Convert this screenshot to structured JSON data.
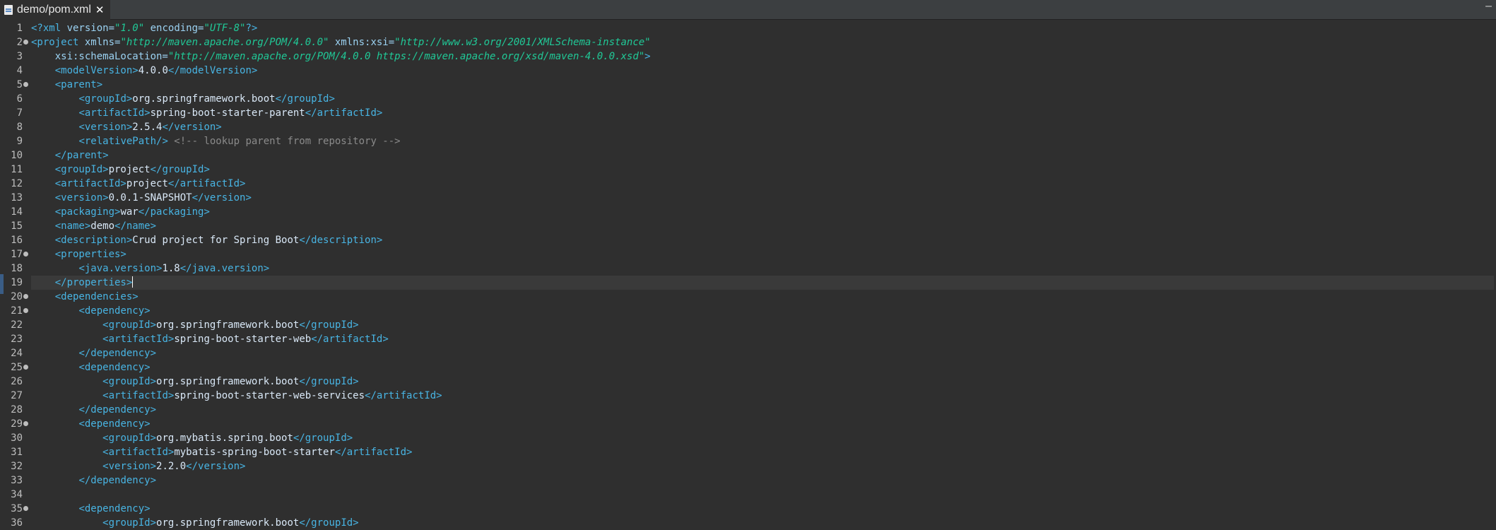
{
  "tab": {
    "title": "demo/pom.xml",
    "close_glyph": "✕"
  },
  "window": {
    "control": "–"
  },
  "lines": [
    {
      "n": "1",
      "segments": [
        [
          "tag",
          "<?xml "
        ],
        [
          "attr",
          "version="
        ],
        [
          "val",
          "\"1.0\""
        ],
        [
          "attr",
          " encoding="
        ],
        [
          "val",
          "\"UTF-8\""
        ],
        [
          "tag",
          "?>"
        ]
      ]
    },
    {
      "n": "2",
      "fold": true,
      "segments": [
        [
          "tag",
          "<project "
        ],
        [
          "attr",
          "xmlns="
        ],
        [
          "val",
          "\"http://maven.apache.org/POM/4.0.0\""
        ],
        [
          "attr",
          " xmlns:xsi="
        ],
        [
          "val",
          "\"http://www.w3.org/2001/XMLSchema-instance\""
        ]
      ]
    },
    {
      "n": "3",
      "segments": [
        [
          "attr",
          "    xsi:schemaLocation="
        ],
        [
          "val",
          "\"http://maven.apache.org/POM/4.0.0 https://maven.apache.org/xsd/maven-4.0.0.xsd\""
        ],
        [
          "tag",
          ">"
        ]
      ]
    },
    {
      "n": "4",
      "segments": [
        [
          "text",
          "    "
        ],
        [
          "tag",
          "<modelVersion>"
        ],
        [
          "text",
          "4.0.0"
        ],
        [
          "tag",
          "</modelVersion>"
        ]
      ]
    },
    {
      "n": "5",
      "fold": true,
      "segments": [
        [
          "text",
          "    "
        ],
        [
          "tag",
          "<parent>"
        ]
      ]
    },
    {
      "n": "6",
      "segments": [
        [
          "text",
          "        "
        ],
        [
          "tag",
          "<groupId>"
        ],
        [
          "text",
          "org.springframework.boot"
        ],
        [
          "tag",
          "</groupId>"
        ]
      ]
    },
    {
      "n": "7",
      "segments": [
        [
          "text",
          "        "
        ],
        [
          "tag",
          "<artifactId>"
        ],
        [
          "text",
          "spring-boot-starter-parent"
        ],
        [
          "tag",
          "</artifactId>"
        ]
      ]
    },
    {
      "n": "8",
      "segments": [
        [
          "text",
          "        "
        ],
        [
          "tag",
          "<version>"
        ],
        [
          "text",
          "2.5.4"
        ],
        [
          "tag",
          "</version>"
        ]
      ]
    },
    {
      "n": "9",
      "segments": [
        [
          "text",
          "        "
        ],
        [
          "tag",
          "<relativePath/>"
        ],
        [
          "comment",
          " <!-- lookup parent from repository -->"
        ]
      ]
    },
    {
      "n": "10",
      "segments": [
        [
          "text",
          "    "
        ],
        [
          "tag",
          "</parent>"
        ]
      ]
    },
    {
      "n": "11",
      "segments": [
        [
          "text",
          "    "
        ],
        [
          "tag",
          "<groupId>"
        ],
        [
          "text",
          "project"
        ],
        [
          "tag",
          "</groupId>"
        ]
      ]
    },
    {
      "n": "12",
      "segments": [
        [
          "text",
          "    "
        ],
        [
          "tag",
          "<artifactId>"
        ],
        [
          "text",
          "project"
        ],
        [
          "tag",
          "</artifactId>"
        ]
      ]
    },
    {
      "n": "13",
      "segments": [
        [
          "text",
          "    "
        ],
        [
          "tag",
          "<version>"
        ],
        [
          "text",
          "0.0.1-SNAPSHOT"
        ],
        [
          "tag",
          "</version>"
        ]
      ]
    },
    {
      "n": "14",
      "segments": [
        [
          "text",
          "    "
        ],
        [
          "tag",
          "<packaging>"
        ],
        [
          "text",
          "war"
        ],
        [
          "tag",
          "</packaging>"
        ]
      ]
    },
    {
      "n": "15",
      "segments": [
        [
          "text",
          "    "
        ],
        [
          "tag",
          "<name>"
        ],
        [
          "text",
          "demo"
        ],
        [
          "tag",
          "</name>"
        ]
      ]
    },
    {
      "n": "16",
      "segments": [
        [
          "text",
          "    "
        ],
        [
          "tag",
          "<description>"
        ],
        [
          "text",
          "Crud project for Spring Boot"
        ],
        [
          "tag",
          "</description>"
        ]
      ]
    },
    {
      "n": "17",
      "fold": true,
      "segments": [
        [
          "text",
          "    "
        ],
        [
          "tag",
          "<properties>"
        ]
      ]
    },
    {
      "n": "18",
      "segments": [
        [
          "text",
          "        "
        ],
        [
          "tag",
          "<java.version>"
        ],
        [
          "text",
          "1.8"
        ],
        [
          "tag",
          "</java.version>"
        ]
      ]
    },
    {
      "n": "19",
      "current": true,
      "segments": [
        [
          "text",
          "    "
        ],
        [
          "tag",
          "</properties>"
        ]
      ]
    },
    {
      "n": "20",
      "fold": true,
      "segments": [
        [
          "text",
          "    "
        ],
        [
          "tag",
          "<dependencies>"
        ]
      ]
    },
    {
      "n": "21",
      "fold": true,
      "segments": [
        [
          "text",
          "        "
        ],
        [
          "tag",
          "<dependency>"
        ]
      ]
    },
    {
      "n": "22",
      "segments": [
        [
          "text",
          "            "
        ],
        [
          "tag",
          "<groupId>"
        ],
        [
          "text",
          "org.springframework.boot"
        ],
        [
          "tag",
          "</groupId>"
        ]
      ]
    },
    {
      "n": "23",
      "segments": [
        [
          "text",
          "            "
        ],
        [
          "tag",
          "<artifactId>"
        ],
        [
          "text",
          "spring-boot-starter-web"
        ],
        [
          "tag",
          "</artifactId>"
        ]
      ]
    },
    {
      "n": "24",
      "segments": [
        [
          "text",
          "        "
        ],
        [
          "tag",
          "</dependency>"
        ]
      ]
    },
    {
      "n": "25",
      "fold": true,
      "segments": [
        [
          "text",
          "        "
        ],
        [
          "tag",
          "<dependency>"
        ]
      ]
    },
    {
      "n": "26",
      "segments": [
        [
          "text",
          "            "
        ],
        [
          "tag",
          "<groupId>"
        ],
        [
          "text",
          "org.springframework.boot"
        ],
        [
          "tag",
          "</groupId>"
        ]
      ]
    },
    {
      "n": "27",
      "segments": [
        [
          "text",
          "            "
        ],
        [
          "tag",
          "<artifactId>"
        ],
        [
          "text",
          "spring-boot-starter-web-services"
        ],
        [
          "tag",
          "</artifactId>"
        ]
      ]
    },
    {
      "n": "28",
      "segments": [
        [
          "text",
          "        "
        ],
        [
          "tag",
          "</dependency>"
        ]
      ]
    },
    {
      "n": "29",
      "fold": true,
      "segments": [
        [
          "text",
          "        "
        ],
        [
          "tag",
          "<dependency>"
        ]
      ]
    },
    {
      "n": "30",
      "segments": [
        [
          "text",
          "            "
        ],
        [
          "tag",
          "<groupId>"
        ],
        [
          "text",
          "org.mybatis.spring.boot"
        ],
        [
          "tag",
          "</groupId>"
        ]
      ]
    },
    {
      "n": "31",
      "segments": [
        [
          "text",
          "            "
        ],
        [
          "tag",
          "<artifactId>"
        ],
        [
          "text",
          "mybatis-spring-boot-starter"
        ],
        [
          "tag",
          "</artifactId>"
        ]
      ]
    },
    {
      "n": "32",
      "segments": [
        [
          "text",
          "            "
        ],
        [
          "tag",
          "<version>"
        ],
        [
          "text",
          "2.2.0"
        ],
        [
          "tag",
          "</version>"
        ]
      ]
    },
    {
      "n": "33",
      "segments": [
        [
          "text",
          "        "
        ],
        [
          "tag",
          "</dependency>"
        ]
      ]
    },
    {
      "n": "34",
      "segments": []
    },
    {
      "n": "35",
      "fold": true,
      "segments": [
        [
          "text",
          "        "
        ],
        [
          "tag",
          "<dependency>"
        ]
      ]
    },
    {
      "n": "36",
      "segments": [
        [
          "text",
          "            "
        ],
        [
          "tag",
          "<groupId>"
        ],
        [
          "text",
          "org.springframework.boot"
        ],
        [
          "tag",
          "</groupId>"
        ]
      ]
    }
  ]
}
